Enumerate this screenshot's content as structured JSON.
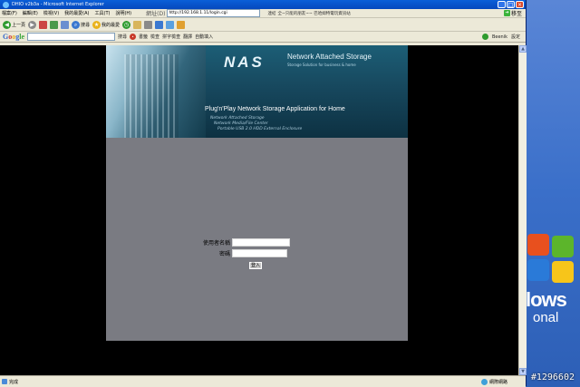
{
  "window": {
    "title": "DHIO v2b3a - Microsoft Internet Explorer",
    "min": "_",
    "max": "□",
    "close": "×"
  },
  "menu": {
    "items": [
      "檔案(F)",
      "編輯(E)",
      "檢視(V)",
      "我的最愛(A)",
      "工具(T)",
      "說明(H)"
    ],
    "address_label": "網址(D)",
    "address_value": "http://192.168.1.11/login.cgi",
    "links_label": "連結",
    "links_text": "全~只能的朋友~~ 巴哈姆特電玩資訊站",
    "go_label": "移至"
  },
  "toolbar": {
    "back_label": "上一頁",
    "search_label": "搜尋",
    "favorites_label": "我的最愛"
  },
  "google": {
    "logo": [
      "G",
      "o",
      "o",
      "g",
      "le"
    ],
    "search_label": "搜尋",
    "items": [
      "書籤",
      "檢查",
      "拼字檢查",
      "翻譯",
      "自動填入"
    ],
    "user": "Beenik",
    "settings": "設定"
  },
  "banner": {
    "logo": "NAS",
    "title": "Network Attached Storage",
    "subtitle": "Storage Solution for business & home",
    "tagline": "Plug'n'Play Network Storage Application for Home",
    "features": [
      "Network Attached Storage",
      "Network Media/File Center",
      "Portable USB 2.0 HDD External Enclosure"
    ]
  },
  "login": {
    "username_label": "使用者名稱",
    "password_label": "密碼",
    "submit_label": "登入"
  },
  "status": {
    "left": "完成",
    "right": "網際網路"
  },
  "desktop": {
    "brand": "lows",
    "sub": "onal",
    "watermark": "#1296602"
  }
}
